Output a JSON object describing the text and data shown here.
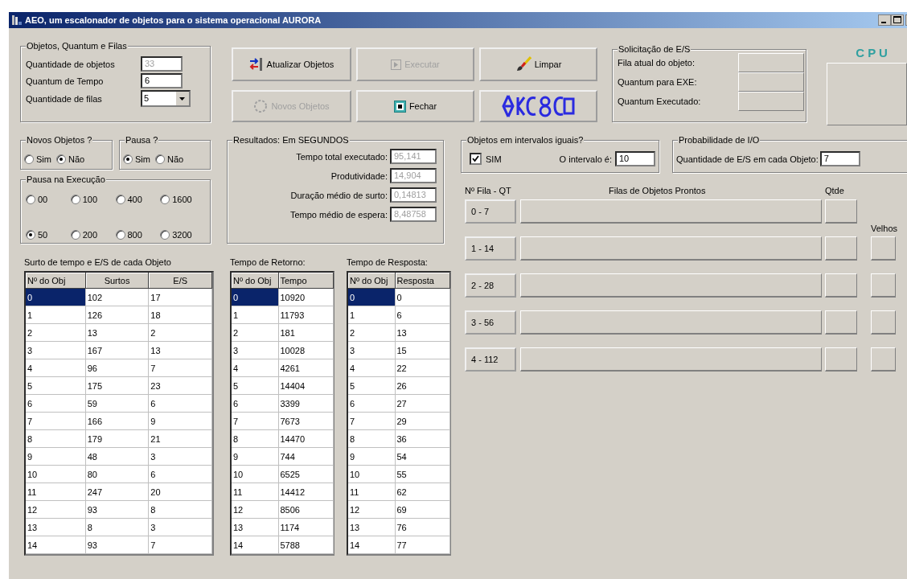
{
  "window": {
    "title": "AEO, um escalonador de objetos para o sistema operacional AURORA"
  },
  "objects_group": {
    "title": "Objetos, Quantum e Filas",
    "fields": [
      {
        "label": "Quantidade de objetos",
        "value": "33",
        "kind": "text",
        "disabled": true
      },
      {
        "label": "Quantum de Tempo",
        "value": "6",
        "kind": "text",
        "disabled": false
      },
      {
        "label": "Quantidade de filas",
        "value": "5",
        "kind": "dropdown"
      }
    ]
  },
  "buttons": [
    {
      "kind": "update",
      "label": "Atualizar Objetos",
      "disabled": false
    },
    {
      "kind": "run",
      "label": "Executar",
      "disabled": true
    },
    {
      "kind": "clear",
      "label": "Limpar",
      "disabled": false
    },
    {
      "kind": "new",
      "label": "Novos Objetos",
      "disabled": true
    },
    {
      "kind": "close",
      "label": "Fechar",
      "disabled": false
    },
    {
      "kind": "logo"
    }
  ],
  "io_request": {
    "title": "Solicitação de E/S",
    "fields": [
      "Fila atual do objeto:",
      "Quantum para EXE:",
      "Quantum Executado:"
    ]
  },
  "cpu": {
    "label": "C P U"
  },
  "new_objects": {
    "title": "Novos Objetos ?",
    "options": [
      {
        "label": "Sim",
        "selected": false
      },
      {
        "label": "Não",
        "selected": true
      }
    ]
  },
  "pause": {
    "title": "Pausa ?",
    "options": [
      {
        "label": "Sim",
        "selected": true
      },
      {
        "label": "Não",
        "selected": false
      }
    ]
  },
  "pause_exec": {
    "title": "Pausa na Execução",
    "options": [
      {
        "label": "00",
        "selected": false
      },
      {
        "label": "100",
        "selected": false
      },
      {
        "label": "400",
        "selected": false
      },
      {
        "label": "1600",
        "selected": false
      },
      {
        "label": "50",
        "selected": true
      },
      {
        "label": "200",
        "selected": false
      },
      {
        "label": "800",
        "selected": false
      },
      {
        "label": "3200",
        "selected": false
      }
    ]
  },
  "results": {
    "title": "Resultados: Em SEGUNDOS",
    "fields": [
      {
        "label": "Tempo total executado:",
        "value": "95,141"
      },
      {
        "label": "Produtividade:",
        "value": "14,904"
      },
      {
        "label": "Duração médio de surto:",
        "value": "0,14813"
      },
      {
        "label": "Tempo médio de espera:",
        "value": "8,48758"
      }
    ]
  },
  "equal_intervals": {
    "title": "Objetos em intervalos iguais?",
    "checkbox": {
      "label": "SIM",
      "checked": true
    },
    "interval_label": "O intervalo é:",
    "interval_value": "10"
  },
  "io_probability": {
    "title": "Probabilidade de I/O",
    "label": "Quantidade de E/S em cada Objeto:",
    "value": "7"
  },
  "queues": {
    "headers": {
      "queue": "Nº Fila - QT",
      "ready": "Filas de Objetos Prontos",
      "count": "Qtde",
      "old": "Velhos"
    },
    "rows": [
      {
        "label": "0 - 7",
        "has_old": false
      },
      {
        "label": "1 - 14",
        "has_old": true
      },
      {
        "label": "2 - 28",
        "has_old": true
      },
      {
        "label": "3 - 56",
        "has_old": true
      },
      {
        "label": "4 - 112",
        "has_old": true
      }
    ]
  },
  "tables": [
    {
      "title": "Surto de tempo e E/S de cada Objeto",
      "columns": [
        "Nº do Obj",
        "Surtos",
        "E/S"
      ],
      "rows": [
        {
          "cells": [
            "0",
            "102",
            "17"
          ],
          "selected": true
        },
        {
          "cells": [
            "1",
            "126",
            "18"
          ],
          "selected": false
        },
        {
          "cells": [
            "2",
            "13",
            "2"
          ],
          "selected": false
        },
        {
          "cells": [
            "3",
            "167",
            "13"
          ],
          "selected": false
        },
        {
          "cells": [
            "4",
            "96",
            "7"
          ],
          "selected": false
        },
        {
          "cells": [
            "5",
            "175",
            "23"
          ],
          "selected": false
        },
        {
          "cells": [
            "6",
            "59",
            "6"
          ],
          "selected": false
        },
        {
          "cells": [
            "7",
            "166",
            "9"
          ],
          "selected": false
        },
        {
          "cells": [
            "8",
            "179",
            "21"
          ],
          "selected": false
        },
        {
          "cells": [
            "9",
            "48",
            "3"
          ],
          "selected": false
        },
        {
          "cells": [
            "10",
            "80",
            "6"
          ],
          "selected": false
        },
        {
          "cells": [
            "11",
            "247",
            "20"
          ],
          "selected": false
        },
        {
          "cells": [
            "12",
            "93",
            "8"
          ],
          "selected": false
        },
        {
          "cells": [
            "13",
            "8",
            "3"
          ],
          "selected": false
        },
        {
          "cells": [
            "14",
            "93",
            "7"
          ],
          "selected": false
        }
      ]
    },
    {
      "title": "Tempo de Retorno:",
      "columns": [
        "Nº do Obj",
        "Tempo"
      ],
      "rows": [
        {
          "cells": [
            "0",
            "10920"
          ],
          "selected": true
        },
        {
          "cells": [
            "1",
            "11793"
          ],
          "selected": false
        },
        {
          "cells": [
            "2",
            "181"
          ],
          "selected": false
        },
        {
          "cells": [
            "3",
            "10028"
          ],
          "selected": false
        },
        {
          "cells": [
            "4",
            "4261"
          ],
          "selected": false
        },
        {
          "cells": [
            "5",
            "14404"
          ],
          "selected": false
        },
        {
          "cells": [
            "6",
            "3399"
          ],
          "selected": false
        },
        {
          "cells": [
            "7",
            "7673"
          ],
          "selected": false
        },
        {
          "cells": [
            "8",
            "14470"
          ],
          "selected": false
        },
        {
          "cells": [
            "9",
            "744"
          ],
          "selected": false
        },
        {
          "cells": [
            "10",
            "6525"
          ],
          "selected": false
        },
        {
          "cells": [
            "11",
            "14412"
          ],
          "selected": false
        },
        {
          "cells": [
            "12",
            "8506"
          ],
          "selected": false
        },
        {
          "cells": [
            "13",
            "1174"
          ],
          "selected": false
        },
        {
          "cells": [
            "14",
            "5788"
          ],
          "selected": false
        }
      ]
    },
    {
      "title": "Tempo de Resposta:",
      "columns": [
        "Nº do Obj",
        "Resposta"
      ],
      "rows": [
        {
          "cells": [
            "0",
            "0"
          ],
          "selected": true
        },
        {
          "cells": [
            "1",
            "6"
          ],
          "selected": false
        },
        {
          "cells": [
            "2",
            "13"
          ],
          "selected": false
        },
        {
          "cells": [
            "3",
            "15"
          ],
          "selected": false
        },
        {
          "cells": [
            "4",
            "22"
          ],
          "selected": false
        },
        {
          "cells": [
            "5",
            "26"
          ],
          "selected": false
        },
        {
          "cells": [
            "6",
            "27"
          ],
          "selected": false
        },
        {
          "cells": [
            "7",
            "29"
          ],
          "selected": false
        },
        {
          "cells": [
            "8",
            "36"
          ],
          "selected": false
        },
        {
          "cells": [
            "9",
            "54"
          ],
          "selected": false
        },
        {
          "cells": [
            "10",
            "55"
          ],
          "selected": false
        },
        {
          "cells": [
            "11",
            "62"
          ],
          "selected": false
        },
        {
          "cells": [
            "12",
            "69"
          ],
          "selected": false
        },
        {
          "cells": [
            "13",
            "76"
          ],
          "selected": false
        },
        {
          "cells": [
            "14",
            "77"
          ],
          "selected": false
        }
      ]
    }
  ]
}
